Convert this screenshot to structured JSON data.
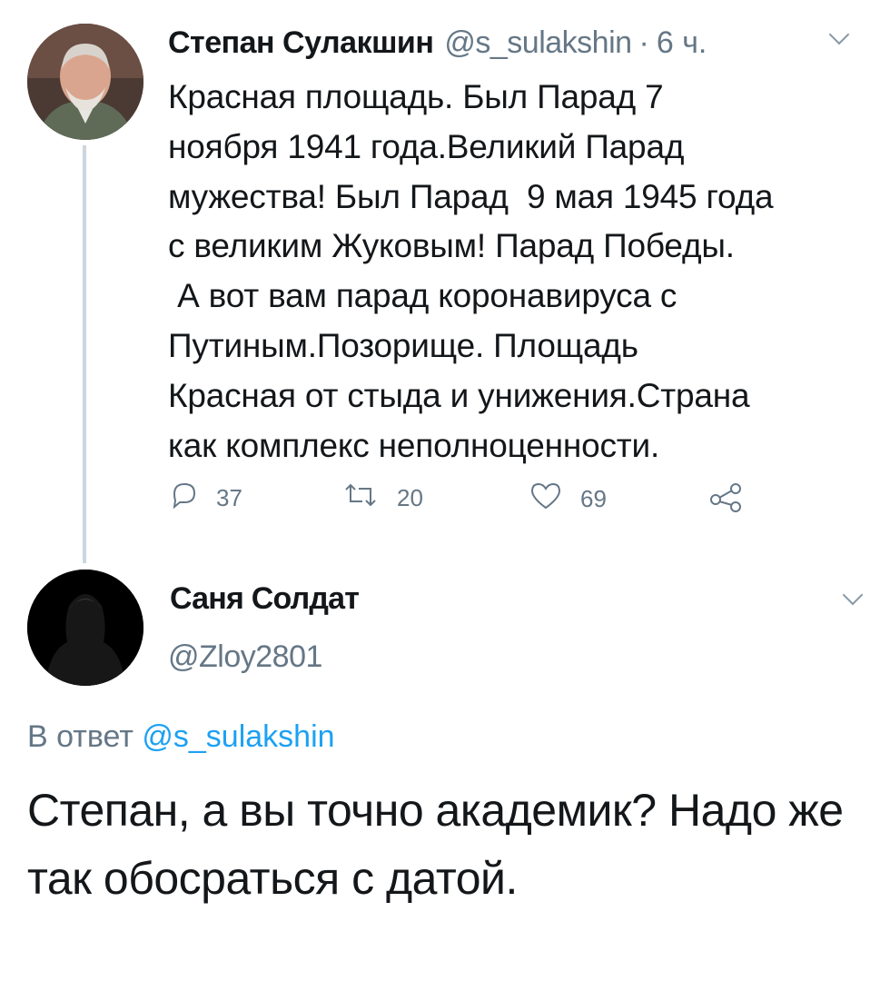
{
  "tweet1": {
    "author_name": "Степан Сулакшин",
    "author_handle": "@s_sulakshin",
    "separator": "·",
    "time": "6 ч.",
    "text": "Красная площадь. Был Парад 7\nноября 1941 года.Великий Парад\nмужества! Был Парад  9 мая 1945 года\nс великим Жуковым! Парад Победы.\n А вот вам парад коронавируса с\nПутиным.Позорище. Площадь\nКрасная от стыда и унижения.Страна\nкак комплекс неполноценности.",
    "replies": "37",
    "retweets": "20",
    "likes": "69"
  },
  "tweet2": {
    "author_name": "Саня Солдат",
    "author_handle": "@Zloy2801",
    "reply_prefix": "В ответ",
    "reply_to_handle": "@s_sulakshin",
    "text": "Степан, а вы точно академик? Надо же так обосраться с датой."
  },
  "icons": {
    "reply": "reply-icon",
    "retweet": "retweet-icon",
    "like": "heart-icon",
    "share": "share-icon",
    "menu": "chevron-down-icon"
  },
  "colors": {
    "text": "#14171a",
    "secondary": "#657786",
    "link": "#1da1f2",
    "thread_line": "#ccd6dd"
  }
}
